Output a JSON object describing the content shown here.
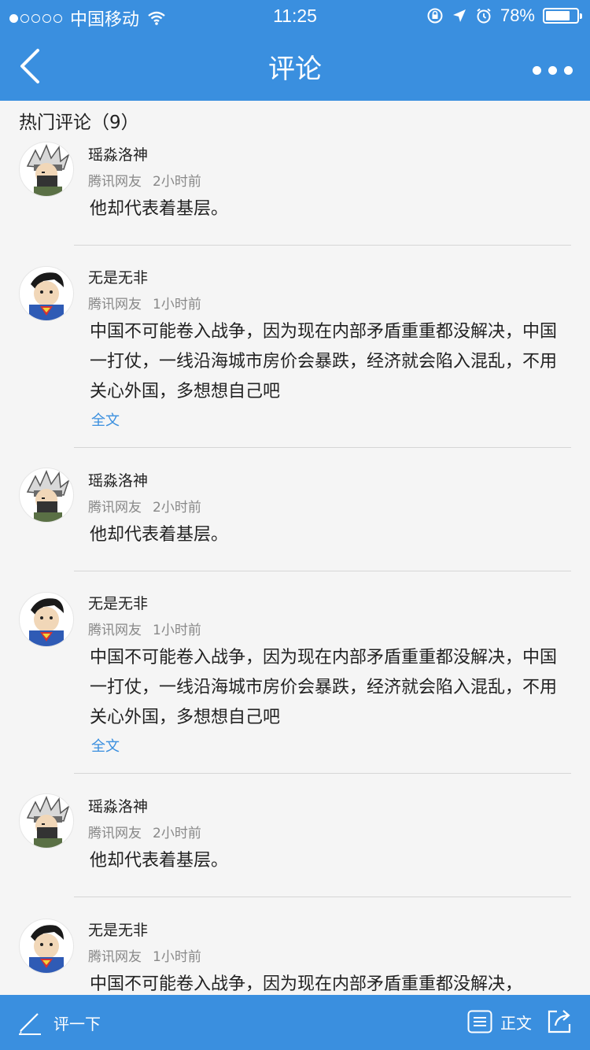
{
  "status_bar": {
    "carrier": "中国移动",
    "time": "11:25",
    "battery": "78%",
    "battery_level": 0.78
  },
  "nav": {
    "title": "评论"
  },
  "section": {
    "title": "热门评论（9）"
  },
  "comments": [
    {
      "user": "瑶淼洛神",
      "source": "腾讯网友",
      "time": "2小时前",
      "text": "他却代表着基层。",
      "avatar": "ninja-avatar-icon"
    },
    {
      "user": "无是无非",
      "source": "腾讯网友",
      "time": "1小时前",
      "text": "中国不可能卷入战争，因为现在内部矛盾重重都没解决，中国一打仗，一线沿海城市房价会暴跌，经济就会陷入混乱，不用关心外国，多想想自己吧",
      "full": "全文",
      "avatar": "superhero-avatar-icon"
    },
    {
      "user": "瑶淼洛神",
      "source": "腾讯网友",
      "time": "2小时前",
      "text": "他却代表着基层。",
      "avatar": "ninja-avatar-icon"
    },
    {
      "user": "无是无非",
      "source": "腾讯网友",
      "time": "1小时前",
      "text": "中国不可能卷入战争，因为现在内部矛盾重重都没解决，中国一打仗，一线沿海城市房价会暴跌，经济就会陷入混乱，不用关心外国，多想想自己吧",
      "full": "全文",
      "avatar": "superhero-avatar-icon"
    },
    {
      "user": "瑶淼洛神",
      "source": "腾讯网友",
      "time": "2小时前",
      "text": "他却代表着基层。",
      "avatar": "ninja-avatar-icon"
    },
    {
      "user": "无是无非",
      "source": "腾讯网友",
      "time": "1小时前",
      "text": "中国不可能卷入战争，因为现在内部矛盾重重都没解决，",
      "avatar": "superhero-avatar-icon"
    }
  ],
  "bottom_bar": {
    "comment_label": "评一下",
    "article_label": "正文"
  },
  "colors": {
    "accent": "#3a8fdf",
    "background": "#f5f5f5",
    "link": "#3a8fdf"
  }
}
